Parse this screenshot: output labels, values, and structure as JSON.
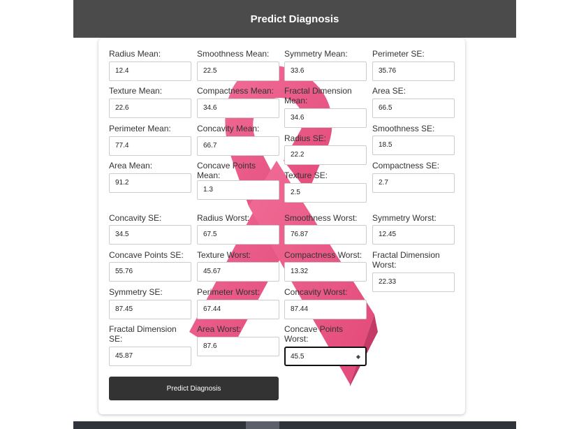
{
  "header": {
    "title": "Predict Diagnosis"
  },
  "colors": {
    "header_bg": "#4b4b4b",
    "button_bg": "#333333",
    "ribbon": "#e8457a"
  },
  "fields": [
    {
      "label": "Radius Mean:",
      "value": "12.4"
    },
    {
      "label": "Texture Mean:",
      "value": "22.6"
    },
    {
      "label": "Perimeter Mean:",
      "value": "77.4"
    },
    {
      "label": "Area Mean:",
      "value": "91.2"
    },
    {
      "label": "Smoothness Mean:",
      "value": "22.5"
    },
    {
      "label": "Compactness Mean:",
      "value": "34.6"
    },
    {
      "label": "Concavity Mean:",
      "value": "66.7"
    },
    {
      "label": "Concave Points Mean:",
      "value": "1.3"
    },
    {
      "label": "Symmetry Mean:",
      "value": "33.6"
    },
    {
      "label": "Fractal Dimension Mean:",
      "value": "34.6"
    },
    {
      "label": "Radius SE:",
      "value": "22.2"
    },
    {
      "label": "Texture SE:",
      "value": "2.5"
    },
    {
      "label": "Perimeter SE:",
      "value": "35.76"
    },
    {
      "label": "Area SE:",
      "value": "66.5"
    },
    {
      "label": "Smoothness SE:",
      "value": "18.5"
    },
    {
      "label": "Compactness SE:",
      "value": "2.7"
    },
    {
      "label": "Concavity SE:",
      "value": "34.5"
    },
    {
      "label": "Concave Points SE:",
      "value": "55.76"
    },
    {
      "label": "Symmetry SE:",
      "value": "87.45"
    },
    {
      "label": "Fractal Dimension SE:",
      "value": "45.87"
    },
    {
      "label": "Radius Worst:",
      "value": "67.5"
    },
    {
      "label": "Texture Worst:",
      "value": "45.67"
    },
    {
      "label": "Perimeter Worst:",
      "value": "67.44"
    },
    {
      "label": "Area Worst:",
      "value": "87.6"
    },
    {
      "label": "Smoothness Worst:",
      "value": "76.87"
    },
    {
      "label": "Compactness Worst:",
      "value": "13.32"
    },
    {
      "label": "Concavity Worst:",
      "value": "87.44"
    },
    {
      "label": "Concave Points Worst:",
      "value": "45.5"
    },
    {
      "label": "Symmetry Worst:",
      "value": "12.45"
    },
    {
      "label": "Fractal Dimension Worst:",
      "value": "22.33"
    }
  ],
  "predict_button": {
    "label": "Predict Diagnosis"
  }
}
